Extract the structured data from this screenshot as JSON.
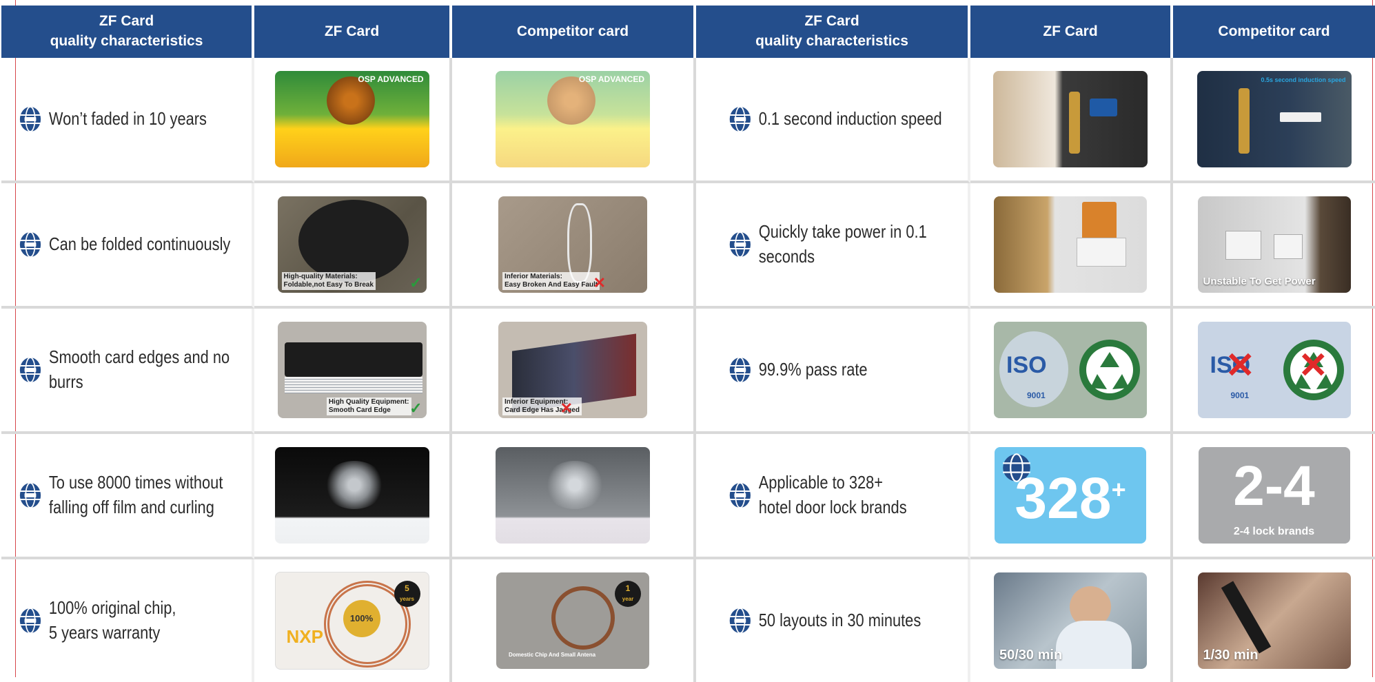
{
  "headers": [
    [
      "ZF Card",
      "quality characteristics"
    ],
    [
      "ZF Card"
    ],
    [
      "Competitor card"
    ],
    [
      "ZF Card",
      "quality characteristics"
    ],
    [
      "ZF Card"
    ],
    [
      "Competitor card"
    ]
  ],
  "rows": [
    {
      "left_feature": [
        "Won’t faded in 10 years"
      ],
      "zf_left": {
        "osp": "OSP ADVANCED"
      },
      "comp_left": {
        "osp": "OSP ADVANCED"
      },
      "right_feature": [
        "0.1 second induction speed"
      ],
      "comp_right": {
        "caption": "0.5s second induction speed"
      }
    },
    {
      "left_feature": [
        "Can be folded continuously"
      ],
      "zf_left": {
        "caption": [
          "High-quality Materials:",
          "Foldable,not Easy To Break"
        ],
        "mark": "✓"
      },
      "comp_left": {
        "caption": [
          "Inferior Materials:",
          "Easy Broken And Easy Fault"
        ],
        "mark": "✕"
      },
      "right_feature": [
        "Quickly take power in 0.1",
        "seconds"
      ],
      "comp_right": {
        "caption": "Unstable To Get Power"
      }
    },
    {
      "left_feature": [
        "Smooth card edges and no",
        "burrs"
      ],
      "zf_left": {
        "caption": [
          "High Quality Equipment:",
          "Smooth Card Edge"
        ],
        "mark": "✓"
      },
      "comp_left": {
        "caption": [
          "Inferior Equipment:",
          "Card Edge Has Jagged"
        ],
        "mark": "✕"
      },
      "right_feature": [
        "99.9% pass rate"
      ],
      "zf_right": {
        "iso": "ISO",
        "iso_num": "9001"
      },
      "comp_right": {
        "iso": "ISO",
        "iso_num": "9001"
      }
    },
    {
      "left_feature": [
        "To use 8000 times without",
        "falling off film and curling"
      ],
      "right_feature": [
        "Applicable to 328+",
        "hotel door lock brands"
      ],
      "zf_right": {
        "num": "328",
        "sup": "+"
      },
      "comp_right": {
        "num": "2-4",
        "caption": "2-4 lock brands"
      }
    },
    {
      "left_feature": [
        "100% original chip,",
        "5 years warranty"
      ],
      "zf_left": {
        "badge": "100%",
        "years": "5",
        "years_label": "years",
        "brand": "NXP"
      },
      "comp_left": {
        "years": "1",
        "years_label": "year",
        "caption": "Domestic Chip And Small Antena"
      },
      "right_feature": [
        "50 layouts in 30 minutes"
      ],
      "zf_right": {
        "caption": "50/30 min"
      },
      "comp_right": {
        "caption": "1/30 min"
      }
    }
  ],
  "colors": {
    "header_bg": "#244e8c",
    "grid": "#d9d9d9",
    "accent_blue": "#6ec6ef",
    "accent_red": "#d6454a"
  },
  "icons": {
    "feature_bullet": "globe-logo-icon"
  }
}
